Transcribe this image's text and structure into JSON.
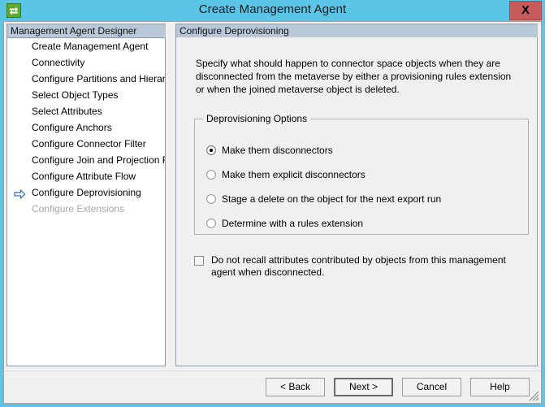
{
  "window": {
    "title": "Create Management Agent",
    "app_icon": "sync-arrows-icon",
    "close_label": "X",
    "titlebar_color": "#5bc5e8",
    "close_color": "#c75b5b"
  },
  "sidebar": {
    "header": "Management Agent Designer",
    "items": [
      {
        "label": "Create Management Agent",
        "state": "done"
      },
      {
        "label": "Connectivity",
        "state": "done"
      },
      {
        "label": "Configure Partitions and Hierarchies",
        "state": "done"
      },
      {
        "label": "Select Object Types",
        "state": "done"
      },
      {
        "label": "Select Attributes",
        "state": "done"
      },
      {
        "label": "Configure Anchors",
        "state": "done"
      },
      {
        "label": "Configure Connector Filter",
        "state": "done"
      },
      {
        "label": "Configure Join and Projection Rules",
        "state": "done"
      },
      {
        "label": "Configure Attribute Flow",
        "state": "done"
      },
      {
        "label": "Configure Deprovisioning",
        "state": "current"
      },
      {
        "label": "Configure Extensions",
        "state": "disabled"
      }
    ],
    "current_marker": "right-arrow-icon"
  },
  "main": {
    "header": "Configure Deprovisioning",
    "description": "Specify what should happen to connector space objects when they are disconnected from the metaverse by either a provisioning rules extension or when the joined metaverse object is deleted.",
    "options_group": {
      "legend": "Deprovisioning Options",
      "options": [
        {
          "label": "Make them disconnectors",
          "selected": true
        },
        {
          "label": "Make them explicit disconnectors",
          "selected": false
        },
        {
          "label": "Stage a delete on the object for the next export run",
          "selected": false
        },
        {
          "label": "Determine with a rules extension",
          "selected": false
        }
      ]
    },
    "recall_checkbox": {
      "label": "Do not recall attributes contributed by objects from this management agent when disconnected.",
      "checked": false
    }
  },
  "footer": {
    "buttons": [
      {
        "label": "< Back",
        "default": false
      },
      {
        "label": "Next >",
        "default": true
      },
      {
        "label": "Cancel",
        "default": false
      },
      {
        "label": "Help",
        "default": false
      }
    ],
    "grip": "resize-grip-icon"
  }
}
